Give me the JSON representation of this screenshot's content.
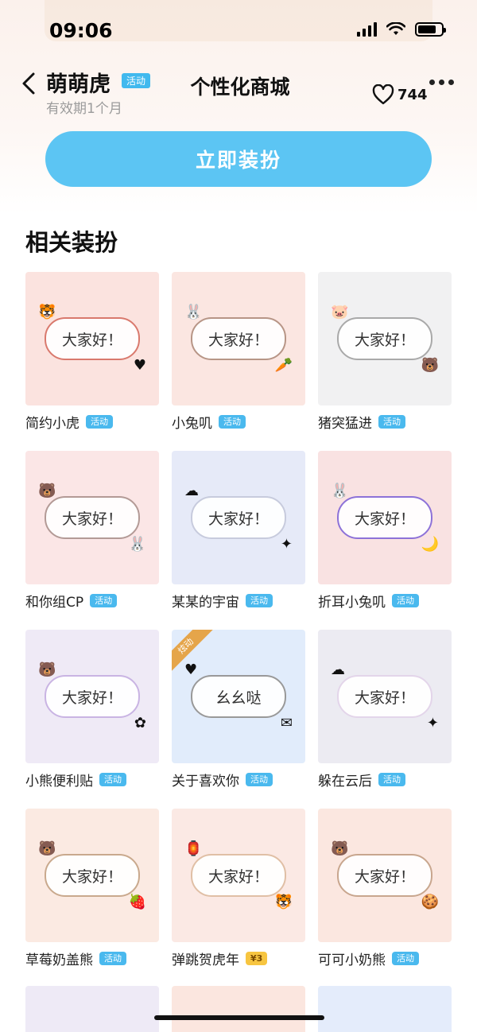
{
  "status_bar": {
    "time": "09:06"
  },
  "header": {
    "title": "萌萌虎",
    "title_badge": "活动",
    "subtitle": "有效期1个月",
    "page_title": "个性化商城",
    "like_count": "744"
  },
  "primary_button": {
    "label": "立即装扮"
  },
  "section": {
    "title": "相关装扮"
  },
  "items": [
    {
      "name": "简约小虎",
      "tag": "活动",
      "preview_text": "大家好！",
      "bg": "#fbe3df",
      "border": "#d9796d"
    },
    {
      "name": "小兔叽",
      "tag": "活动",
      "preview_text": "大家好！",
      "bg": "#fbe6e1",
      "border": "#b79586"
    },
    {
      "name": "猪突猛进",
      "tag": "活动",
      "preview_text": "大家好！",
      "bg": "#f1f1f2",
      "border": "#a9a9a9"
    },
    {
      "name": "和你组CP",
      "tag": "活动",
      "preview_text": "大家好！",
      "bg": "#fbe6e6",
      "border": "#b39a96"
    },
    {
      "name": "某某的宇宙",
      "tag": "活动",
      "preview_text": "大家好！",
      "bg": "#e6eaf8",
      "border": "#c7cbdd"
    },
    {
      "name": "折耳小兔叽",
      "tag": "活动",
      "preview_text": "大家好！",
      "bg": "#f9e2e2",
      "border": "#8d72d8"
    },
    {
      "name": "小熊便利贴",
      "tag": "活动",
      "preview_text": "大家好！",
      "bg": "#efeaf6",
      "border": "#c9b4e3"
    },
    {
      "name": "关于喜欢你",
      "tag": "活动",
      "preview_text": "幺幺哒",
      "bg": "#e1ecfb",
      "border": "#999999",
      "corner": "炫动"
    },
    {
      "name": "躲在云后",
      "tag": "活动",
      "preview_text": "大家好！",
      "bg": "#ecebf2",
      "border": "#e3d5ea"
    },
    {
      "name": "草莓奶盖熊",
      "tag": "活动",
      "preview_text": "大家好！",
      "bg": "#fbeae2",
      "border": "#c9a98d"
    },
    {
      "name": "弹跳贺虎年",
      "tag": "¥3",
      "price": true,
      "preview_text": "大家好！",
      "bg": "#fbe9e4",
      "border": "#e0bfa5"
    },
    {
      "name": "可可小奶熊",
      "tag": "活动",
      "preview_text": "大家好！",
      "bg": "#fbe7e0",
      "border": "#c8a68e"
    }
  ],
  "colors": {
    "accent": "#5cc5f3",
    "tag": "#4ab9ee",
    "price_tag": "#f7c540"
  },
  "icons": [
    "back-icon",
    "heart-icon",
    "more-icon",
    "wifi-icon",
    "signal-icon",
    "battery-icon"
  ]
}
